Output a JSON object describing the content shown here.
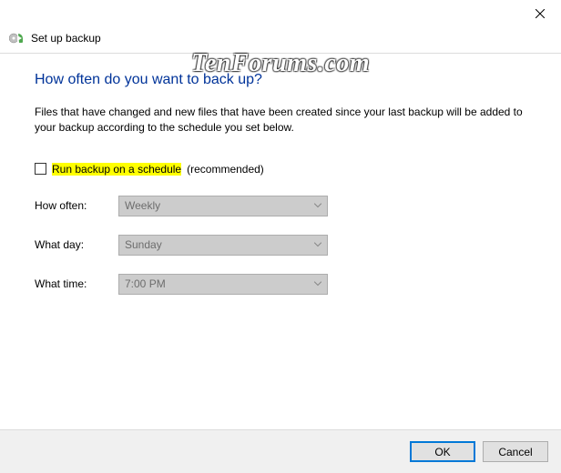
{
  "window": {
    "title": "Set up backup"
  },
  "watermark": "TenForums.com",
  "main": {
    "heading": "How often do you want to back up?",
    "description": "Files that have changed and new files that have been created since your last backup will be added to your backup according to the schedule you set below.",
    "schedule_checkbox": {
      "label": "Run backup on a schedule",
      "recommended": "(recommended)",
      "checked": false
    },
    "fields": {
      "how_often": {
        "label": "How often:",
        "value": "Weekly"
      },
      "what_day": {
        "label": "What day:",
        "value": "Sunday"
      },
      "what_time": {
        "label": "What time:",
        "value": "7:00 PM"
      }
    }
  },
  "buttons": {
    "ok": "OK",
    "cancel": "Cancel"
  }
}
